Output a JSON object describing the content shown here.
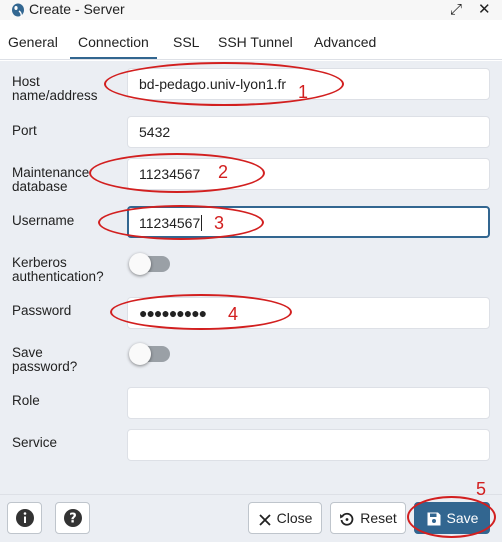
{
  "window": {
    "title": "Create - Server",
    "icons": {
      "app": "elephant-icon",
      "expand": "expand-icon",
      "close": "close-icon"
    }
  },
  "tabs": [
    {
      "label": "General"
    },
    {
      "label": "Connection",
      "active": true
    },
    {
      "label": "SSL"
    },
    {
      "label": "SSH Tunnel"
    },
    {
      "label": "Advanced"
    }
  ],
  "form": {
    "host": {
      "label_line1": "Host",
      "label_line2": "name/address",
      "value": "bd-pedago.univ-lyon1.fr"
    },
    "port": {
      "label": "Port",
      "value": "5432"
    },
    "maintenance_db": {
      "label_line1": "Maintenance",
      "label_line2": "database",
      "value": "11234567"
    },
    "username": {
      "label": "Username",
      "value": "11234567"
    },
    "kerberos": {
      "label_line1": "Kerberos",
      "label_line2": "authentication?",
      "enabled": false
    },
    "password": {
      "label": "Password",
      "value": "●●●●●●●●●"
    },
    "save_password": {
      "label_line1": "Save",
      "label_line2": "password?",
      "enabled": false
    },
    "role": {
      "label": "Role",
      "value": ""
    },
    "service": {
      "label": "Service",
      "value": ""
    }
  },
  "annotations": {
    "color": "#d21f1f",
    "numbers": [
      "1",
      "2",
      "3",
      "4",
      "5"
    ]
  },
  "footer": {
    "info_icon": "info-icon",
    "help_icon": "help-icon",
    "close_label": "Close",
    "reset_label": "Reset",
    "save_label": "Save"
  },
  "colors": {
    "accent": "#326690",
    "form_bg": "#ebeef3"
  }
}
